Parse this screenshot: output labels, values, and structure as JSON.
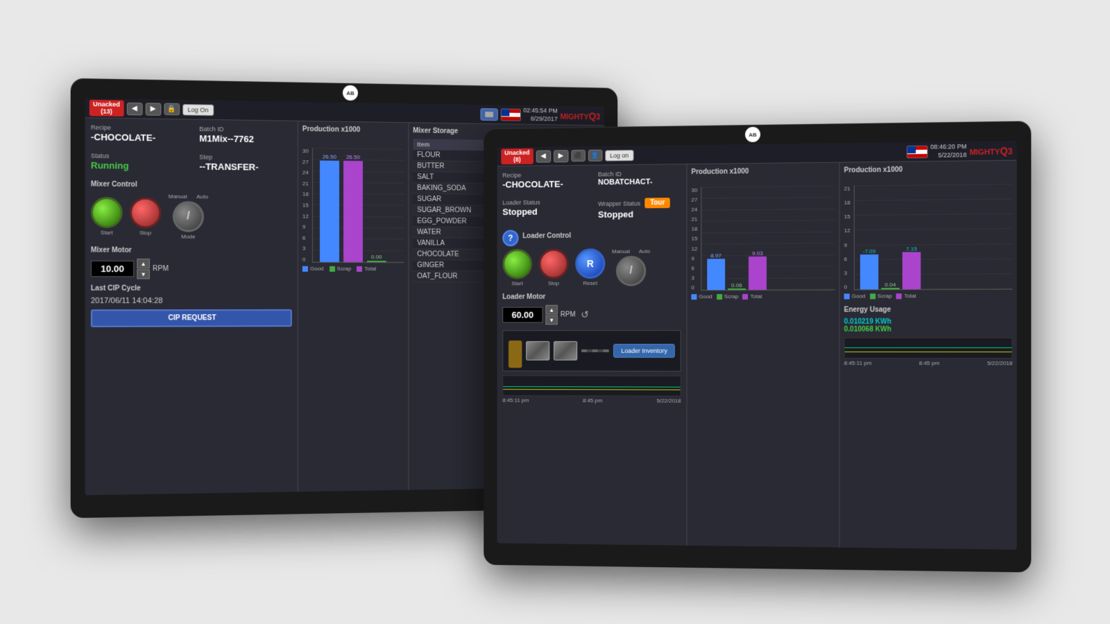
{
  "scene": {
    "bg_color": "#e8e8e8"
  },
  "tablet1": {
    "topbar": {
      "alarm_label": "Unacked",
      "alarm_count": "(13)",
      "logon_label": "Log On",
      "time": "02:45:54 PM",
      "date": "8/29/2017",
      "ab_logo": "AB"
    },
    "header": {
      "recipe_label": "Recipe",
      "recipe_value": "-CHOCOLATE-",
      "batch_label": "Batch ID",
      "batch_value": "M1Mix--7762",
      "status_label": "Status",
      "status_value": "Running",
      "step_label": "Step",
      "step_value": "--TRANSFER-"
    },
    "mixer_control": {
      "title": "Mixer Control",
      "start_label": "Start",
      "stop_label": "Stop",
      "mode_label": "Mode",
      "manual_label": "Manual",
      "auto_label": "Auto"
    },
    "mixer_motor": {
      "title": "Mixer Motor",
      "value": "10.00",
      "unit": "RPM"
    },
    "cip": {
      "title": "Last CIP Cycle",
      "date": "2017/06/11 14:04:28",
      "button_label": "CIP REQUEST"
    },
    "production": {
      "title": "Production x1000",
      "y_labels": [
        "30",
        "27",
        "24",
        "21",
        "18",
        "15",
        "12",
        "9",
        "6",
        "3",
        "0"
      ],
      "bar1_value": "26.50",
      "bar2_value": "26.50",
      "bar3_value": "0.00",
      "legend_good": "Good",
      "legend_scrap": "Scrap",
      "legend_total": "Total"
    },
    "storage": {
      "title": "Mixer Storage",
      "col_item": "Item",
      "items": [
        "FLOUR",
        "BUTTER",
        "SALT",
        "BAKING_SODA",
        "SUGAR",
        "SUGAR_BROWN",
        "EGG_POWDER",
        "WATER",
        "VANILLA",
        "CHOCOLATE",
        "GINGER",
        "OAT_FLOUR"
      ]
    }
  },
  "tablet2": {
    "topbar": {
      "alarm_label": "Unacked",
      "alarm_count": "(8)",
      "logon_label": "Log on",
      "time": "08:46:20 PM",
      "date": "5/22/2018",
      "ab_logo": "AB"
    },
    "header": {
      "recipe_label": "Recipe",
      "recipe_value": "-CHOCOLATE-",
      "batch_label": "Batch ID",
      "batch_value": "NOBATCHACT-",
      "loader_status_label": "Loader Status",
      "loader_status_value": "Stopped",
      "wrapper_status_label": "Wrapper Status",
      "wrapper_status_value": "Stopped",
      "tour_badge": "Tour"
    },
    "loader_control": {
      "title": "Loader Control",
      "start_label": "Start",
      "stop_label": "Stop",
      "reset_label": "Reset",
      "manual_label": "Manual",
      "auto_label": "Auto"
    },
    "loader_motor": {
      "title": "Loader Motor",
      "value": "60.00",
      "unit": "RPM"
    },
    "production_loader": {
      "title": "Production x1000",
      "bar_good_value": "8.97",
      "bar_scrap_value": "0.06",
      "bar_total_value": "9.03",
      "legend_good": "Good",
      "legend_scrap": "Scrap",
      "legend_total": "Total"
    },
    "production_wrapper": {
      "title": "Production x1000",
      "bar_good_value": "-7.09",
      "bar_scrap_value": "0.04",
      "bar_total_value": "7.15",
      "legend_good": "Good",
      "legend_scrap": "Scrap",
      "legend_total": "Total"
    },
    "energy": {
      "title": "Energy Usage",
      "value1_label": "0.010219 KWh",
      "value2_label": "0.010068 KWh"
    },
    "loader_inventory_btn": "Loader Inventory"
  }
}
